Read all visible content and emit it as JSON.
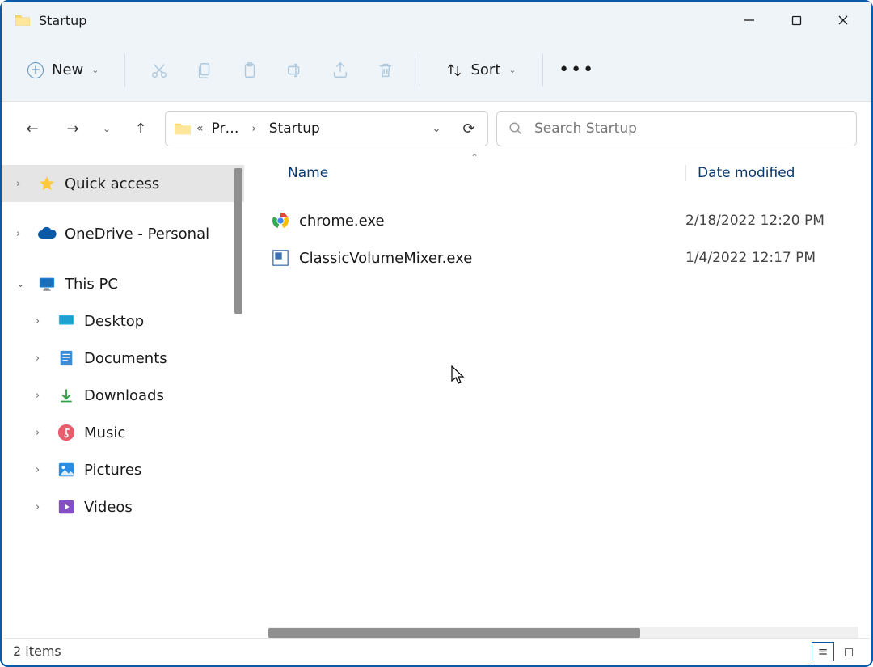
{
  "window": {
    "title": "Startup"
  },
  "toolbar": {
    "new_label": "New",
    "sort_label": "Sort",
    "icons": {
      "cut": "cut",
      "copy": "copy",
      "paste": "paste",
      "rename": "rename",
      "share": "share",
      "delete": "delete"
    }
  },
  "nav": {
    "breadcrumb_parent": "Pr…",
    "breadcrumb_current": "Startup"
  },
  "search": {
    "placeholder": "Search Startup"
  },
  "sidebar": {
    "quick_access": "Quick access",
    "onedrive": "OneDrive - Personal",
    "this_pc": "This PC",
    "items": [
      {
        "label": "Desktop",
        "icon": "desktop"
      },
      {
        "label": "Documents",
        "icon": "documents"
      },
      {
        "label": "Downloads",
        "icon": "downloads"
      },
      {
        "label": "Music",
        "icon": "music"
      },
      {
        "label": "Pictures",
        "icon": "pictures"
      },
      {
        "label": "Videos",
        "icon": "videos"
      }
    ]
  },
  "columns": {
    "name": "Name",
    "date": "Date modified"
  },
  "files": [
    {
      "name": "chrome.exe",
      "date": "2/18/2022 12:20 PM",
      "icon": "chrome"
    },
    {
      "name": "ClassicVolumeMixer.exe",
      "date": "1/4/2022 12:17 PM",
      "icon": "app"
    }
  ],
  "status": {
    "item_count": "2 items"
  }
}
